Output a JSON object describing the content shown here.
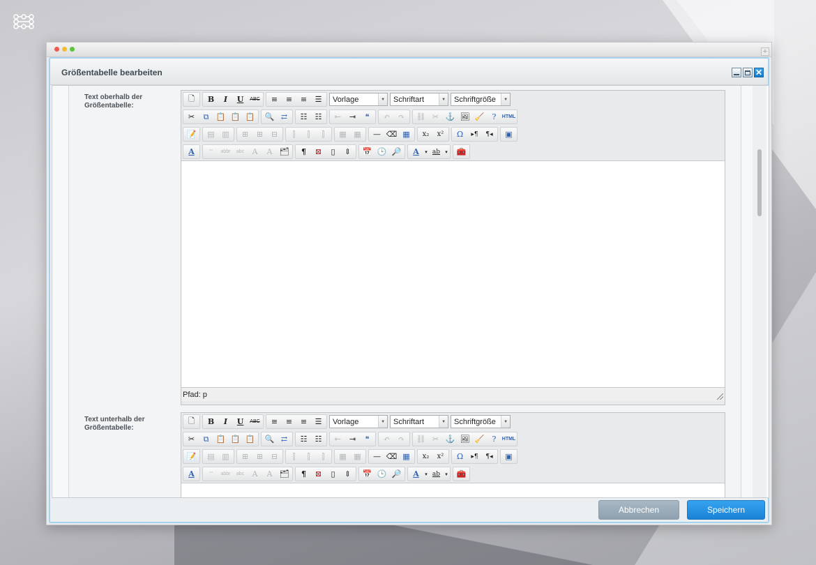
{
  "dialog": {
    "title": "Größentabelle bearbeiten",
    "cancel_label": "Abbrechen",
    "save_label": "Speichern",
    "min_icon": "minimize-icon",
    "max_icon": "maximize-icon",
    "close_icon": "close-icon",
    "close_glyph": "✕"
  },
  "fields": [
    {
      "label": "Text oberhalb der Größentabelle:",
      "status_path": "Pfad: p"
    },
    {
      "label": "Text unterhalb der Größentabelle:"
    }
  ],
  "editor_toolbar": {
    "format_combo": "Vorlage",
    "font_combo": "Schriftart",
    "size_combo": "Schriftgröße",
    "bold": "B",
    "italic": "I",
    "underline": "U",
    "strike": "ABC",
    "html": "HTML"
  },
  "colors": {
    "accent": "#1b82d6",
    "cancel": "#8ea1b0",
    "dialog_border": "#a6d3ee"
  }
}
